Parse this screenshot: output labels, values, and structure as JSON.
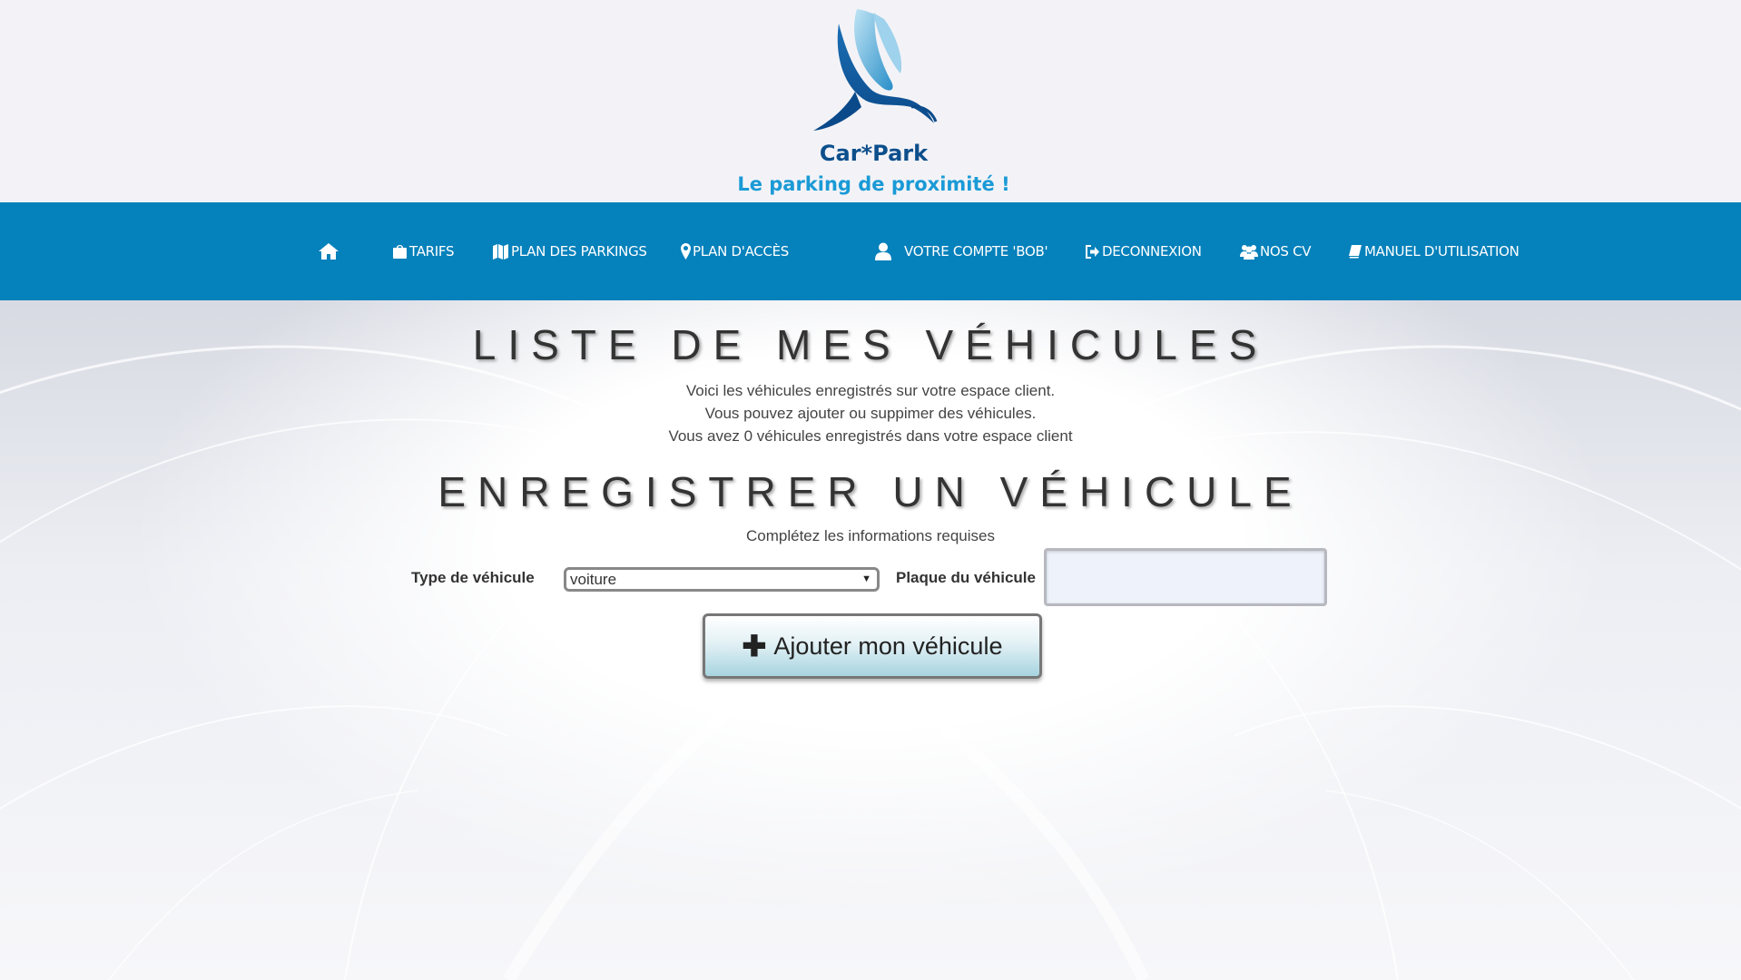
{
  "header": {
    "brand": "Car*Park",
    "tagline": "Le parking de proximité !"
  },
  "nav": {
    "home_icon": "home-icon",
    "items": [
      {
        "label": "TARIFS",
        "icon": "shopping-bag-icon"
      },
      {
        "label": "PLAN DES PARKINGS",
        "icon": "map-icon"
      },
      {
        "label": "PLAN D'ACCÈS",
        "icon": "map-marker-icon"
      },
      {
        "label": "VOTRE COMPTE 'BOB'",
        "icon": "user-icon"
      },
      {
        "label": "DECONNEXION",
        "icon": "sign-out-icon"
      },
      {
        "label": "NOS CV",
        "icon": "users-icon"
      },
      {
        "label": "MANUEL D'UTILISATION",
        "icon": "book-icon"
      }
    ]
  },
  "vehicles": {
    "title": "LISTE DE MES VÉHICULES",
    "line1": "Voici les véhicules enregistrés sur votre espace client.",
    "line2": "Vous pouvez ajouter ou suppimer des véhicules.",
    "line3": "Vous avez 0 véhicules enregistrés dans votre espace client"
  },
  "register": {
    "title": "ENREGISTRER UN VÉHICULE",
    "subtitle": "Complétez les informations requises",
    "type_label": "Type de véhicule",
    "type_value": "voiture",
    "plate_label": "Plaque du véhicule",
    "plate_value": "",
    "button_label": "Ajouter mon véhicule"
  },
  "colors": {
    "nav_bg": "#0581bb",
    "brand_dark": "#0d4f8c",
    "brand_light": "#1a9ad6"
  }
}
